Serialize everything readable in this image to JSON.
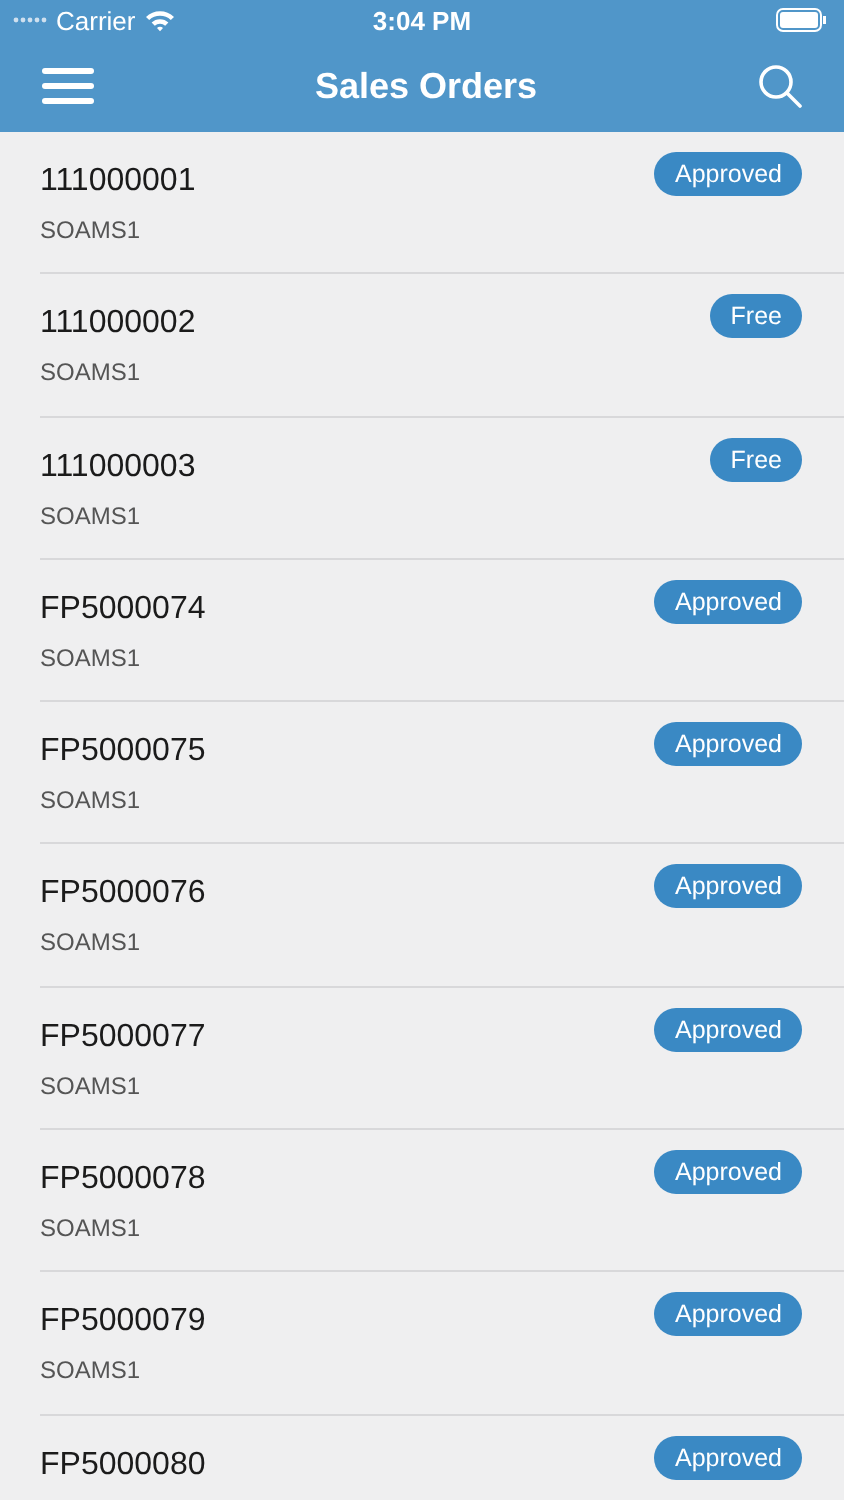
{
  "status_bar": {
    "carrier": "Carrier",
    "time": "3:04 PM"
  },
  "nav": {
    "title": "Sales Orders"
  },
  "orders": [
    {
      "number": "111000001",
      "owner": "SOAMS1",
      "status": "Approved"
    },
    {
      "number": "111000002",
      "owner": "SOAMS1",
      "status": "Free"
    },
    {
      "number": "111000003",
      "owner": "SOAMS1",
      "status": "Free"
    },
    {
      "number": "FP5000074",
      "owner": "SOAMS1",
      "status": "Approved"
    },
    {
      "number": "FP5000075",
      "owner": "SOAMS1",
      "status": "Approved"
    },
    {
      "number": "FP5000076",
      "owner": "SOAMS1",
      "status": "Approved"
    },
    {
      "number": "FP5000077",
      "owner": "SOAMS1",
      "status": "Approved"
    },
    {
      "number": "FP5000078",
      "owner": "SOAMS1",
      "status": "Approved"
    },
    {
      "number": "FP5000079",
      "owner": "SOAMS1",
      "status": "Approved"
    },
    {
      "number": "FP5000080",
      "status": "Approved"
    }
  ]
}
